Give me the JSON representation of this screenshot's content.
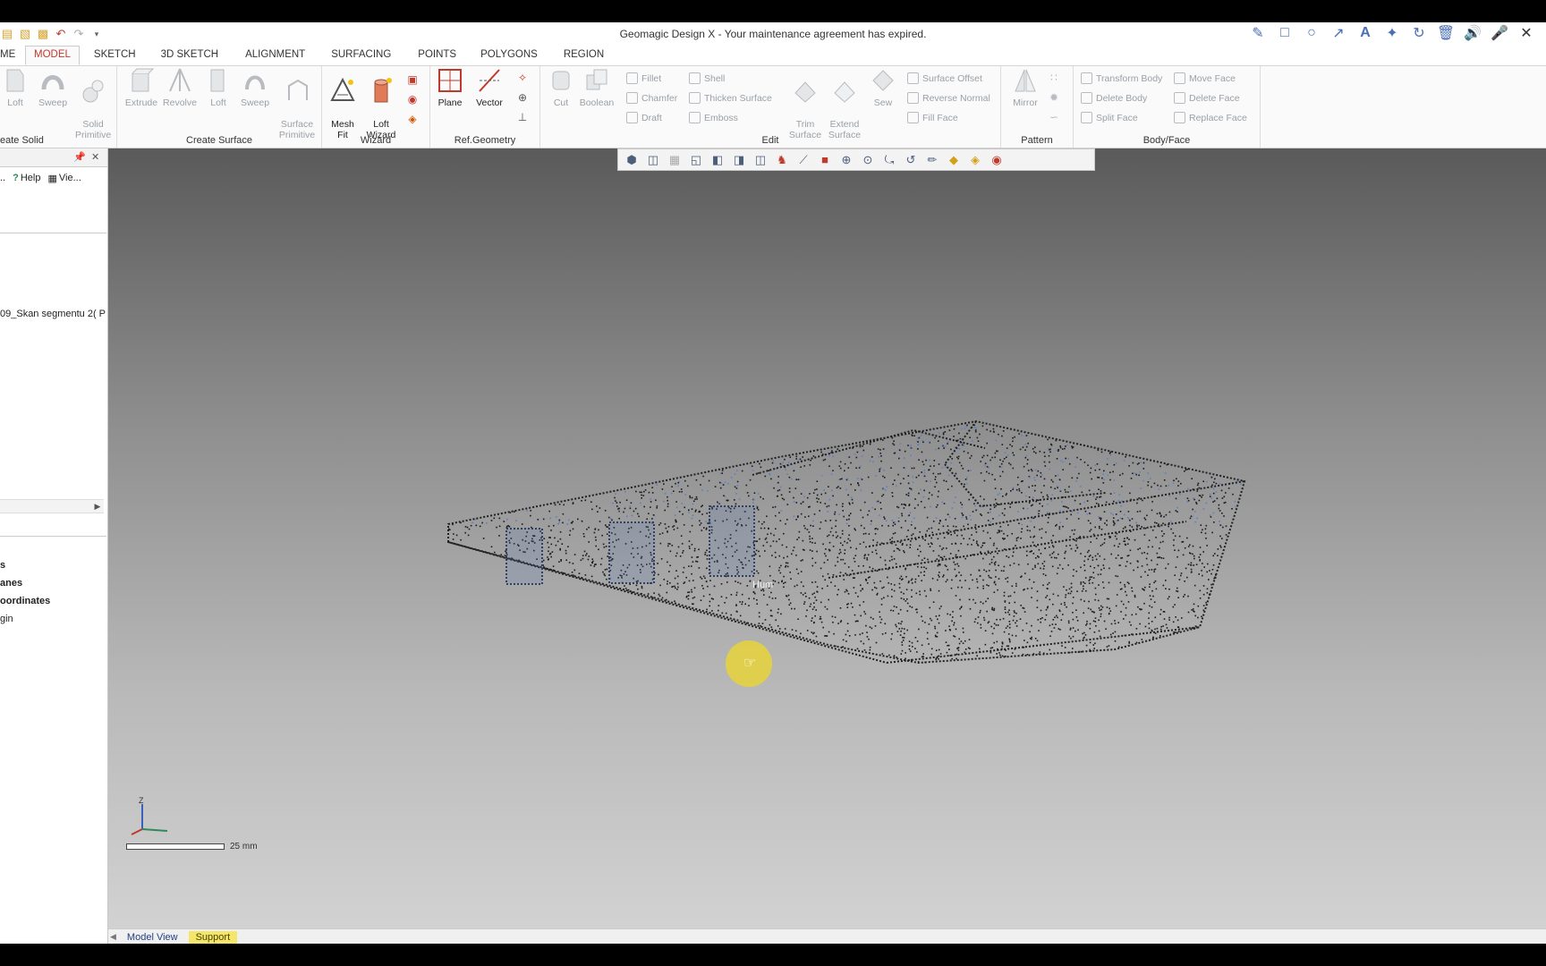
{
  "window": {
    "title": "Geomagic Design X - Your maintenance agreement has expired."
  },
  "quick_access": [
    "folder-new-icon",
    "folder-open-icon",
    "save-icon",
    "undo-icon",
    "redo-icon",
    "dropdown-icon"
  ],
  "overlay_tools": [
    "pencil-icon",
    "rectangle-icon",
    "circle-icon",
    "arrow-icon",
    "text-icon",
    "magic-wand-icon",
    "rotate-icon",
    "trash-icon",
    "speaker-icon",
    "mic-off-icon",
    "close-icon"
  ],
  "tabs": [
    {
      "label": "ME",
      "active": false
    },
    {
      "label": "MODEL",
      "active": true
    },
    {
      "label": "SKETCH",
      "active": false
    },
    {
      "label": "3D SKETCH",
      "active": false
    },
    {
      "label": "ALIGNMENT",
      "active": false
    },
    {
      "label": "SURFACING",
      "active": false
    },
    {
      "label": "POINTS",
      "active": false
    },
    {
      "label": "POLYGONS",
      "active": false
    },
    {
      "label": "REGION",
      "active": false
    }
  ],
  "ribbon": {
    "create_solid": {
      "label": "eate Solid",
      "tools": [
        "Loft",
        "Sweep",
        "Solid\nPrimitive"
      ]
    },
    "create_surface": {
      "label": "Create Surface",
      "tools": [
        "Extrude",
        "Revolve",
        "Loft",
        "Sweep",
        "Surface\nPrimitive"
      ]
    },
    "wizard": {
      "label": "Wizard",
      "tools": [
        "Mesh\nFit",
        "Loft\nWizard"
      ]
    },
    "ref_geometry": {
      "label": "Ref.Geometry",
      "tools": [
        "Plane",
        "Vector"
      ]
    },
    "edit": {
      "label": "Edit",
      "big_tools": [
        "Cut",
        "Boolean"
      ],
      "small_tools": [
        "Fillet",
        "Chamfer",
        "Draft",
        "Shell",
        "Thicken Surface",
        "Emboss"
      ],
      "mid_tools": [
        "Trim\nSurface",
        "Extend\nSurface",
        "Sew"
      ],
      "right_tools": [
        "Surface Offset",
        "Reverse Normal",
        "Fill Face"
      ]
    },
    "pattern": {
      "label": "Pattern",
      "tools": [
        "Mirror"
      ]
    },
    "body_face": {
      "label": "Body/Face",
      "tools": [
        "Transform Body",
        "Delete Body",
        "Split Face",
        "Move Face",
        "Delete Face",
        "Replace Face"
      ]
    }
  },
  "left_panel": {
    "toolbar": {
      "more": "..",
      "help": "Help",
      "view": "Vie..."
    },
    "tree_item": "09_Skan segmentu 2( P",
    "tree_lower": [
      "s",
      "anes",
      "oordinates",
      "gin"
    ]
  },
  "viewport": {
    "cursor_label": "Hum",
    "scale_label": "25 mm",
    "triad_axis": "Z"
  },
  "bottom_tabs": [
    {
      "label": "Model View",
      "active": false
    },
    {
      "label": "Support",
      "active": true
    }
  ],
  "colors": {
    "accent_tab": "#c0392b",
    "support_tab": "#f4e66a",
    "point_cloud": "#1a1a1a",
    "cloud_highlight": "#5b7fc2",
    "cursor_highlight": "#e7d43a"
  }
}
